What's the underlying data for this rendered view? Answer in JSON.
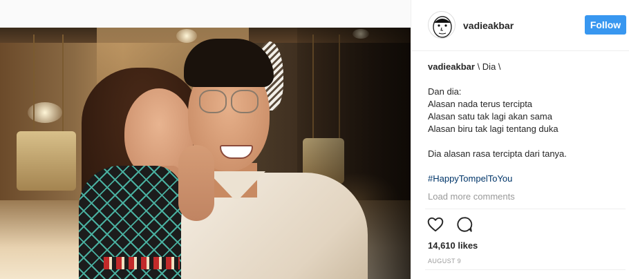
{
  "post": {
    "photo_alt": "",
    "author": {
      "username": "vadieakbar",
      "follow_label": "Follow"
    },
    "caption": {
      "username": "vadieakbar",
      "title": "\\ Dia \\",
      "stanza_lines": [
        "Dan dia:",
        "Alasan nada terus tercipta",
        "Alasan satu tak lagi akan sama",
        "Alasan biru tak lagi tentang duka"
      ],
      "closing_line": "Dia alasan rasa tercipta dari tanya.",
      "hashtag": "#HappyTompelToYou"
    },
    "load_more_label": "Load more comments",
    "actions": {
      "like_icon": "heart-outline-icon",
      "comment_icon": "speech-bubble-icon"
    },
    "likes_text": "14,610 likes",
    "date_text": "AUGUST 9"
  },
  "colors": {
    "follow_button": "#3897f0",
    "hashtag": "#003569",
    "muted_text": "#999999",
    "text": "#262626",
    "page_bg": "#fafafa"
  }
}
